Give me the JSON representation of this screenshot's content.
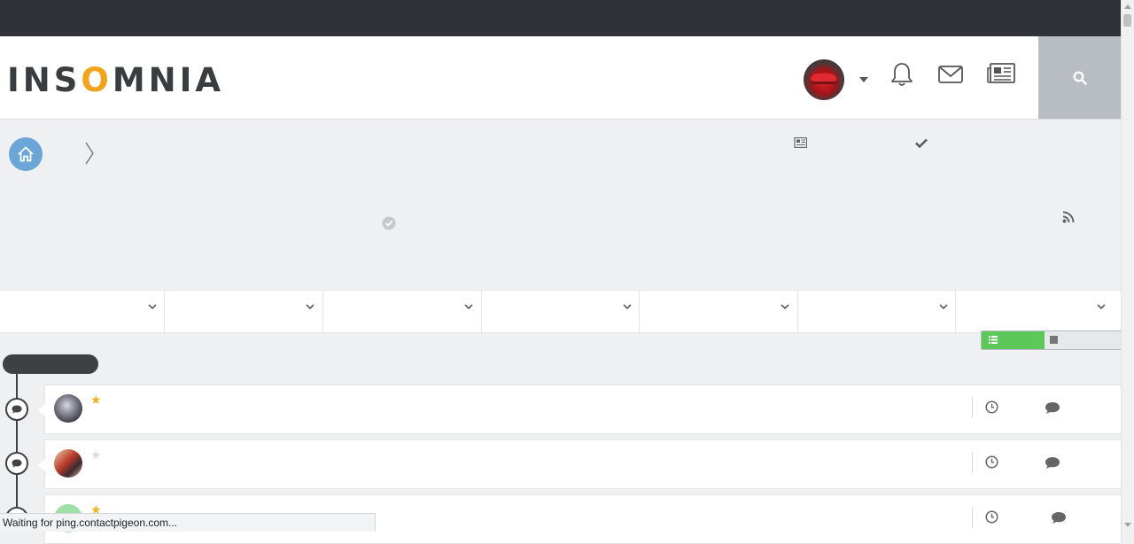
{
  "header": {
    "logo_prefix": "INS",
    "logo_o": "O",
    "logo_suffix": "MNIA"
  },
  "icons": {
    "avatar": "avatar-red-car",
    "bell": "bell-icon",
    "mail": "mail-icon",
    "news": "newspaper-icon",
    "search": "search-icon",
    "home": "home-icon",
    "rss": "rss-icon",
    "check": "check-icon",
    "verified": "check-circle-icon",
    "clock": "clock-icon",
    "comment": "comment-icon"
  },
  "colors": {
    "topbar": "#2f3236",
    "accent_green": "#5cc85a",
    "home_blue": "#6aa6d8",
    "star_active": "#f3b31b",
    "star_inactive": "#dcdcdc"
  },
  "threads": [
    {
      "starred": true
    },
    {
      "starred": false
    },
    {
      "starred": true
    }
  ],
  "status_bar": {
    "text": "Waiting for ping.contactpigeon.com..."
  }
}
